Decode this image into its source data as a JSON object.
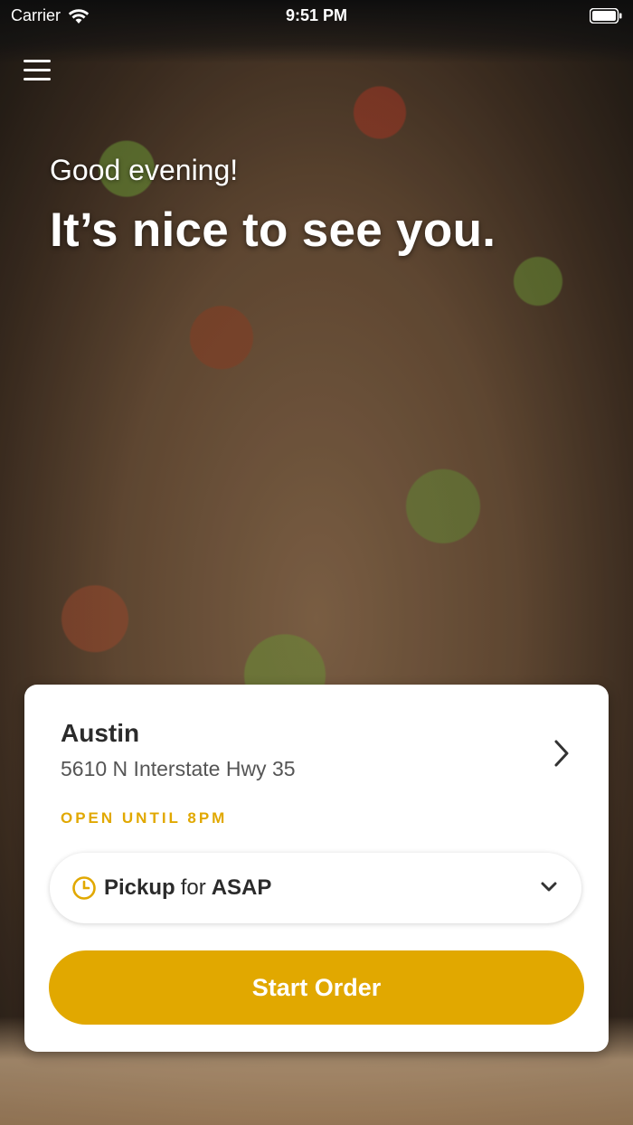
{
  "status_bar": {
    "carrier": "Carrier",
    "time": "9:51 PM"
  },
  "greeting": {
    "salutation": "Good evening!",
    "headline": "It’s nice to see you."
  },
  "location": {
    "name": "Austin",
    "address": "5610 N Interstate Hwy 35",
    "hours": "OPEN UNTIL 8PM"
  },
  "order_type": {
    "mode": "Pickup",
    "connector": "for",
    "timing": "ASAP"
  },
  "actions": {
    "start_order_label": "Start Order"
  },
  "colors": {
    "accent": "#e1a800",
    "card_bg": "#ffffff",
    "text_primary": "#2b2b2b"
  },
  "icons": [
    "wifi-icon",
    "battery-icon",
    "menu-icon",
    "chevron-right-icon",
    "clock-icon",
    "chevron-down-icon"
  ]
}
